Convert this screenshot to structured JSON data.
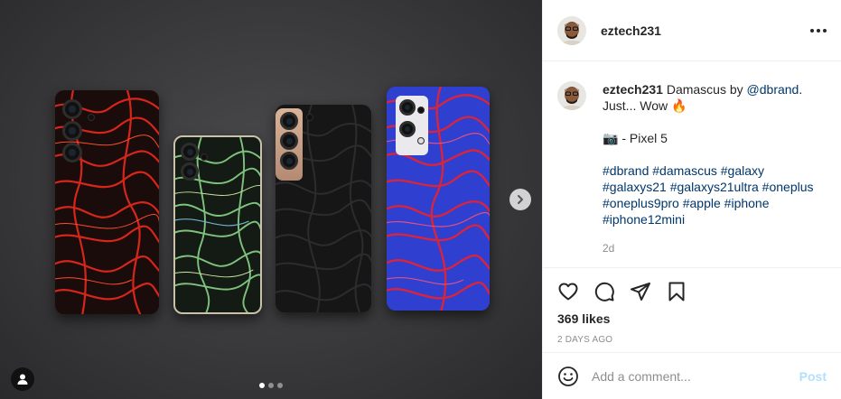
{
  "post": {
    "username": "eztech231",
    "media": {
      "carousel_total": 3,
      "carousel_active": 1,
      "phones": [
        {
          "name": "galaxy-s21-ultra",
          "skin_color": "#d6261c",
          "base_color": "#1a0c0b"
        },
        {
          "name": "iphone-12-mini",
          "skin_color": "#7ec27e",
          "base_color": "#141a14"
        },
        {
          "name": "galaxy-s21",
          "skin_color": "#2a2a2a",
          "base_color": "#161616"
        },
        {
          "name": "oneplus-9-pro",
          "skin_color": "#d8243c",
          "base_color": "#2d3dc9"
        }
      ]
    },
    "header": {
      "username": "eztech231",
      "more_icon": "more-horizontal-icon"
    },
    "caption": {
      "username": "eztech231",
      "text_before_mention": " Damascus by ",
      "mention": "@dbrand",
      "text_after_mention": ".",
      "line2": "Just... Wow 🔥",
      "camera_line": "📷 - Pixel 5",
      "hashtags_line1": "#dbrand #damascus #galaxy",
      "hashtags_line2": "#galaxys21 #galaxys21ultra #oneplus",
      "hashtags_line3": "#oneplus9pro #apple #iphone",
      "hashtags_line4": "#iphone12mini",
      "age": "2d"
    },
    "actions": {
      "like_icon": "heart-icon",
      "comment_icon": "comment-icon",
      "share_icon": "share-icon",
      "save_icon": "bookmark-icon"
    },
    "likes": "369 likes",
    "date": "2 DAYS AGO",
    "comment_box": {
      "emoji_icon": "emoji-icon",
      "placeholder": "Add a comment...",
      "post_label": "Post",
      "post_color": "#b2dffc"
    }
  }
}
